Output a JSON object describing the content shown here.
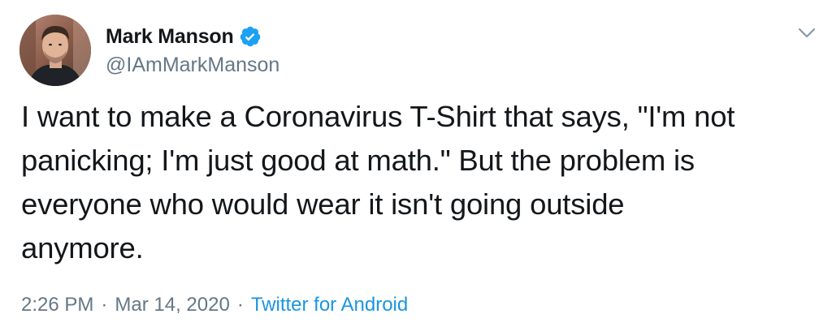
{
  "tweet": {
    "author": {
      "display_name": "Mark Manson",
      "handle": "@IAmMarkManson",
      "verified": true,
      "verified_icon": "verified-badge-icon",
      "avatar": "profile-photo"
    },
    "text": "I want to make a Coronavirus T-Shirt that says, \"I'm not\npanicking; I'm just good at math.\" But the problem is\neveryone who would wear it isn't going outside\nanymore.",
    "time": "2:26 PM",
    "separator": "·",
    "date": "Mar 14, 2020",
    "source": "Twitter for Android",
    "menu_icon": "chevron-down-icon"
  },
  "colors": {
    "text": "#14171a",
    "secondary": "#657786",
    "link": "#1b95e0",
    "verified": "#1da1f2"
  }
}
